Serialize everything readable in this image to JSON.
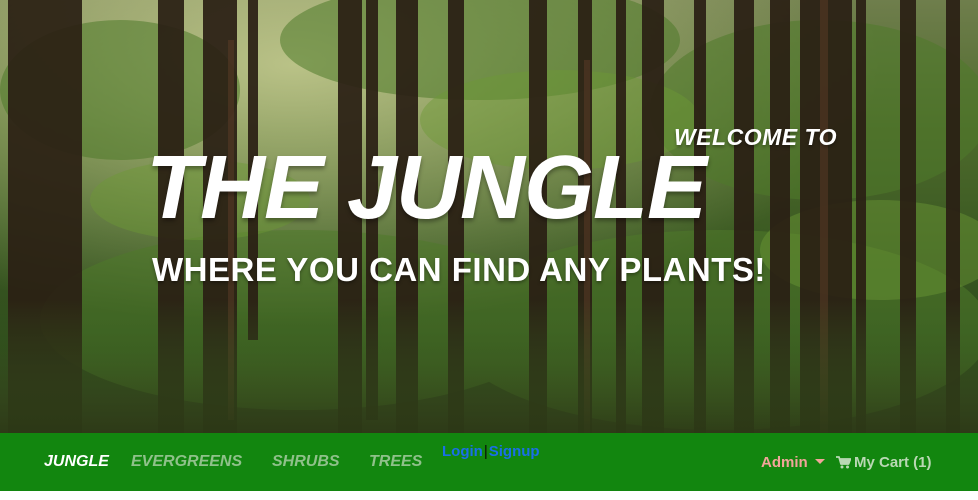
{
  "hero": {
    "welcome": "WELCOME TO",
    "title": "THE JUNGLE",
    "subtitle": "WHERE YOU CAN FIND ANY PLANTS!"
  },
  "navbar": {
    "brand": "JUNGLE",
    "links": [
      "EVERGREENS",
      "SHRUBS",
      "TREES"
    ],
    "login": "Login",
    "separator": "|",
    "signup": "Signup",
    "admin": "Admin",
    "cart": "My Cart (1)"
  },
  "colors": {
    "navbar_bg": "#12860f",
    "nav_link_muted": "#8fc18a",
    "auth_link": "#1a6fe8",
    "admin_text": "#f2a59a"
  },
  "icons": {
    "admin_dropdown": "caret-down-icon",
    "cart": "shopping-cart-icon"
  }
}
